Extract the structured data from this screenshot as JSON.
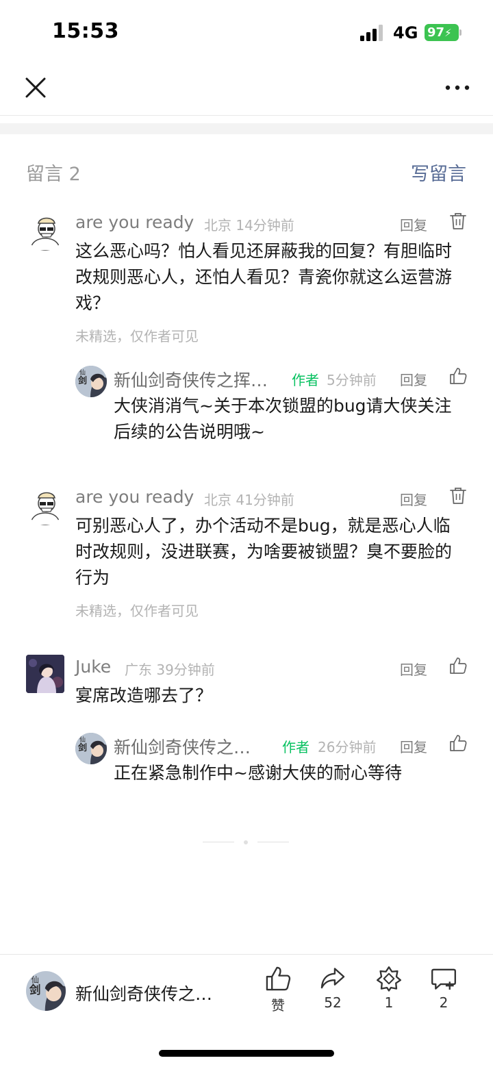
{
  "status_bar": {
    "time": "15:53",
    "network": "4G",
    "battery": "97"
  },
  "section": {
    "title": "留言 2",
    "write_label": "写留言"
  },
  "comments": [
    {
      "name": "are you ready",
      "location": "北京",
      "time": "14分钟前",
      "reply": "回复",
      "text": "这么恶心吗？怕人看见还屏蔽我的回复？有胆临时改规则恶心人，还怕人看见？青瓷你就这么运营游戏？",
      "note": "未精选，仅作者可见",
      "replies": [
        {
          "name": "新仙剑奇侠传之挥…",
          "tag": "作者",
          "time": "5分钟前",
          "reply": "回复",
          "text": "大侠消消气~关于本次锁盟的bug请大侠关注后续的公告说明哦~"
        }
      ]
    },
    {
      "name": "are you ready",
      "location": "北京",
      "time": "41分钟前",
      "reply": "回复",
      "text": "可别恶心人了，办个活动不是bug，就是恶心人临时改规则，没进联赛，为啥要被锁盟？臭不要脸的行为",
      "note": "未精选，仅作者可见"
    },
    {
      "name": "Juke",
      "location": "广东",
      "time": "39分钟前",
      "reply": "回复",
      "text": "宴席改造哪去了？",
      "replies": [
        {
          "name": "新仙剑奇侠传之…",
          "tag": "作者",
          "time": "26分钟前",
          "reply": "回复",
          "text": "正在紧急制作中~感谢大侠的耐心等待"
        }
      ]
    }
  ],
  "bottom_bar": {
    "account_name": "新仙剑奇侠传之…",
    "like_label": "赞",
    "share_count": "52",
    "recommend_count": "1",
    "comment_count": "2"
  },
  "icons": [
    "close-icon",
    "more-icon",
    "trash-icon",
    "thumb-up-icon",
    "share-icon",
    "recommend-icon",
    "comment-icon"
  ],
  "colors": {
    "link": "#576b95",
    "author_tag": "#07c160",
    "battery": "#3cc351"
  }
}
